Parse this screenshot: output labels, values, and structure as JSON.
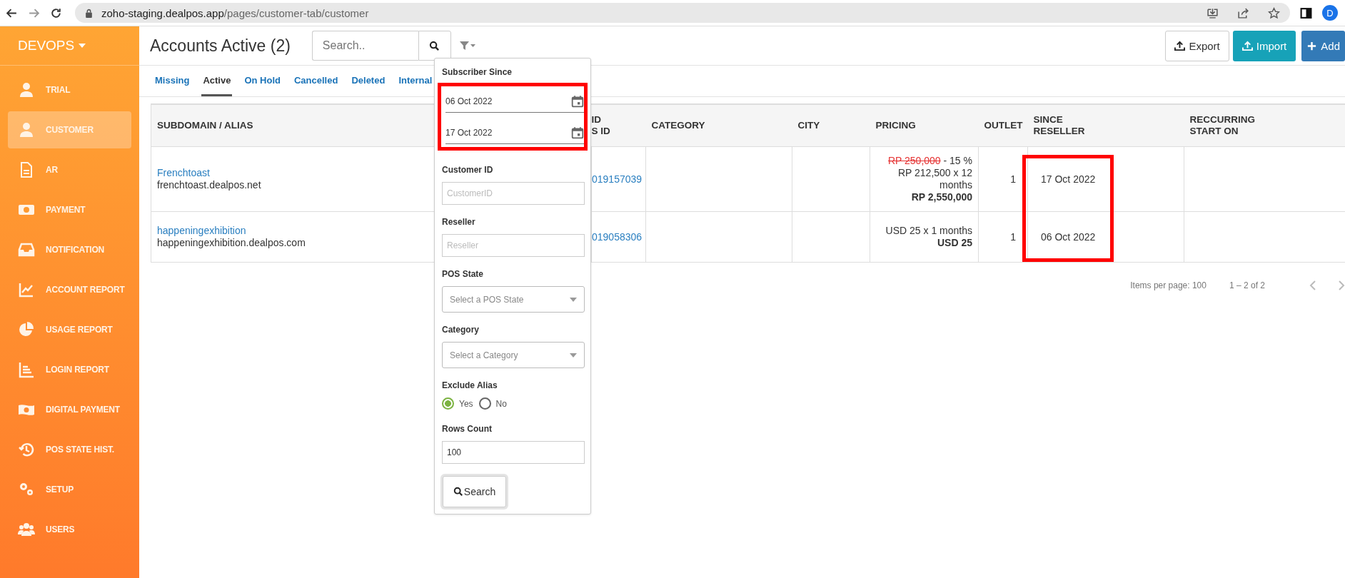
{
  "browser": {
    "host": "zoho-staging.dealpos.app",
    "path": "/pages/customer-tab/customer",
    "avatar": "D"
  },
  "sidebar": {
    "brand": "DEVOPS",
    "items": [
      {
        "label": "TRIAL",
        "selected": false
      },
      {
        "label": "CUSTOMER",
        "selected": true
      },
      {
        "label": "AR",
        "selected": false
      },
      {
        "label": "PAYMENT",
        "selected": false
      },
      {
        "label": "NOTIFICATION",
        "selected": false
      },
      {
        "label": "ACCOUNT REPORT",
        "selected": false
      },
      {
        "label": "USAGE REPORT",
        "selected": false
      },
      {
        "label": "LOGIN REPORT",
        "selected": false
      },
      {
        "label": "DIGITAL PAYMENT",
        "selected": false
      },
      {
        "label": "POS STATE HIST.",
        "selected": false
      },
      {
        "label": "SETUP",
        "selected": false
      },
      {
        "label": "USERS",
        "selected": false
      }
    ]
  },
  "header": {
    "title": "Accounts Active (2)",
    "search": {
      "placeholder": "Search.."
    },
    "buttons": [
      {
        "label": "Export",
        "kind": "outline"
      },
      {
        "label": "Import",
        "kind": "teal"
      },
      {
        "label": "Add",
        "kind": "primary"
      }
    ]
  },
  "tabs": [
    {
      "label": "Missing",
      "selected": false
    },
    {
      "label": "Active",
      "selected": true
    },
    {
      "label": "On Hold",
      "selected": false
    },
    {
      "label": "Cancelled",
      "selected": false
    },
    {
      "label": "Deleted",
      "selected": false
    },
    {
      "label": "Internal",
      "selected": false
    }
  ],
  "filter": {
    "subscriber_since": {
      "label": "Subscriber Since",
      "from": "06 Oct 2022",
      "to": "17 Oct 2022",
      "highlighted": true
    },
    "customer_id": {
      "label": "Customer ID",
      "placeholder": "CustomerID"
    },
    "reseller": {
      "label": "Reseller",
      "placeholder": "Reseller"
    },
    "pos_state": {
      "label": "POS State",
      "placeholder": "Select a POS State"
    },
    "category": {
      "label": "Category",
      "placeholder": "Select a Category"
    },
    "exclude_alias": {
      "label": "Exclude Alias",
      "options": [
        {
          "label": "Yes",
          "selected": true
        },
        {
          "label": "No",
          "selected": false
        }
      ]
    },
    "rows_count": {
      "label": "Rows Count",
      "value": "100"
    },
    "search_button": "Search"
  },
  "table": {
    "columns": [
      {
        "lines": [
          "SUBDOMAIN / ALIAS"
        ]
      },
      {
        "lines": [
          "ID",
          "S ID"
        ]
      },
      {
        "lines": [
          "CATEGORY"
        ]
      },
      {
        "lines": [
          "CITY"
        ]
      },
      {
        "lines": [
          "PRICING"
        ]
      },
      {
        "lines": [
          "OUTLET"
        ]
      },
      {
        "lines": [
          "SINCE",
          "RESELLER"
        ]
      },
      {
        "lines": [
          "RECCURRING",
          "START ON"
        ]
      }
    ],
    "rows": [
      {
        "alias": "Frenchtoast",
        "subdomain": "frenchtoast.dealpos.net",
        "id": "019157039",
        "pricing": {
          "original": "RP 250,000",
          "discount": "- 15 %",
          "rate": "RP 212,500 x 12 months",
          "total": "RP 2,550,000"
        },
        "outlet": "1",
        "since_reseller": "17 Oct 2022"
      },
      {
        "alias": "happeningexhibition",
        "subdomain": "happeningexhibition.dealpos.com",
        "id": "019058306",
        "pricing": {
          "rate": "USD 25 x 1 months",
          "total": "USD 25"
        },
        "outlet": "1",
        "since_reseller": "06 Oct 2022"
      }
    ],
    "since_highlighted": true
  },
  "pagination": {
    "items_per_page": "Items per page: 100",
    "range": "1 – 2 of 2"
  }
}
